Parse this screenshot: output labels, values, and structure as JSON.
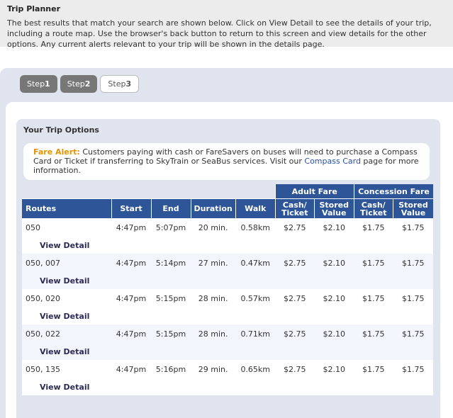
{
  "header": {
    "title": "Trip Planner",
    "intro": "The best results that match your search are shown below. Click on View Detail to see the details of your trip, including a route map. Use the browser's back button to return to this screen and view details for the other options. Any current alerts relevant to your trip will be shown in the details page."
  },
  "steps": [
    {
      "prefix": "Step",
      "num": "1"
    },
    {
      "prefix": "Step",
      "num": "2"
    },
    {
      "prefix": "Step",
      "num": "3"
    }
  ],
  "panel": {
    "title": "Your Trip Options",
    "alert": {
      "label": "Fare Alert:",
      "text1": " Customers paying with cash or FareSavers on buses will need to purchase a Compass Card or Ticket if transferring to SkyTrain or SeaBus services. Visit our ",
      "link": "Compass Card",
      "text2": " page for more information."
    }
  },
  "table": {
    "groups": {
      "adult": "Adult Fare",
      "concession": "Concession Fare"
    },
    "columns": {
      "routes": "Routes",
      "start": "Start",
      "end": "End",
      "duration": "Duration",
      "walk": "Walk",
      "adult_cash_1": "Cash/",
      "adult_cash_2": "Ticket",
      "adult_stored_1": "Stored",
      "adult_stored_2": "Value",
      "con_cash_1": "Cash/",
      "con_cash_2": "Ticket",
      "con_stored_1": "Stored",
      "con_stored_2": "Value"
    },
    "detail_label": "View Detail",
    "rows": [
      {
        "routes": "050",
        "start": "4:47pm",
        "end": "5:07pm",
        "duration": "20 min.",
        "walk": "0.58km",
        "adult_cash": "$2.75",
        "adult_stored": "$2.10",
        "con_cash": "$1.75",
        "con_stored": "$1.75"
      },
      {
        "routes": "050, 007",
        "start": "4:47pm",
        "end": "5:14pm",
        "duration": "27 min.",
        "walk": "0.47km",
        "adult_cash": "$2.75",
        "adult_stored": "$2.10",
        "con_cash": "$1.75",
        "con_stored": "$1.75"
      },
      {
        "routes": "050, 020",
        "start": "4:47pm",
        "end": "5:15pm",
        "duration": "28 min.",
        "walk": "0.57km",
        "adult_cash": "$2.75",
        "adult_stored": "$2.10",
        "con_cash": "$1.75",
        "con_stored": "$1.75"
      },
      {
        "routes": "050, 022",
        "start": "4:47pm",
        "end": "5:15pm",
        "duration": "28 min.",
        "walk": "0.71km",
        "adult_cash": "$2.75",
        "adult_stored": "$2.10",
        "con_cash": "$1.75",
        "con_stored": "$1.75"
      },
      {
        "routes": "050, 135",
        "start": "4:47pm",
        "end": "5:16pm",
        "duration": "29 min.",
        "walk": "0.65km",
        "adult_cash": "$2.75",
        "adult_stored": "$2.10",
        "con_cash": "$1.75",
        "con_stored": "$1.75"
      }
    ]
  }
}
